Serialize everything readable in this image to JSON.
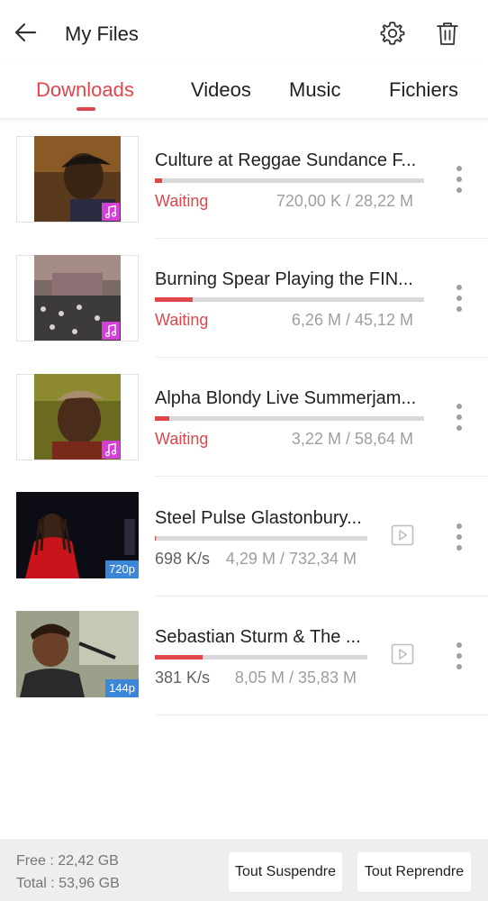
{
  "header": {
    "title": "My Files",
    "back_icon": "arrow-left-icon",
    "settings_icon": "gear-icon",
    "delete_icon": "trash-icon"
  },
  "tabs": [
    {
      "label": "Downloads",
      "active": true
    },
    {
      "label": "Videos",
      "active": false
    },
    {
      "label": "Music",
      "active": false
    },
    {
      "label": "Fichiers",
      "active": false
    }
  ],
  "colors": {
    "accent": "#e0464a",
    "music_badge": "#d43fd7",
    "resolution_badge": "#3b86d6"
  },
  "downloads": [
    {
      "name": "Culture at Reggae Sundance F...",
      "status": "Waiting",
      "size": "720,00 K / 28,22 M",
      "progress": 0.026,
      "type": "music"
    },
    {
      "name": "Burning Spear Playing the FIN...",
      "status": "Waiting",
      "size": "6,26 M / 45,12 M",
      "progress": 0.139,
      "type": "music"
    },
    {
      "name": "Alpha Blondy Live Summerjam...",
      "status": "Waiting",
      "size": "3,22 M / 58,64 M",
      "progress": 0.055,
      "type": "music"
    },
    {
      "name": "Steel Pulse Glastonbury...",
      "speed": "698 K/s",
      "size": "4,29 M / 732,34 M",
      "progress": 0.006,
      "type": "video",
      "resolution": "720p"
    },
    {
      "name": "Sebastian Sturm & The ...",
      "speed": "381 K/s",
      "size": "8,05 M / 35,83 M",
      "progress": 0.225,
      "type": "video",
      "resolution": "144p"
    }
  ],
  "footer": {
    "free": "Free : 22,42 GB",
    "total": "Total : 53,96 GB",
    "suspend_all": "Tout Suspendre",
    "resume_all": "Tout Reprendre"
  }
}
